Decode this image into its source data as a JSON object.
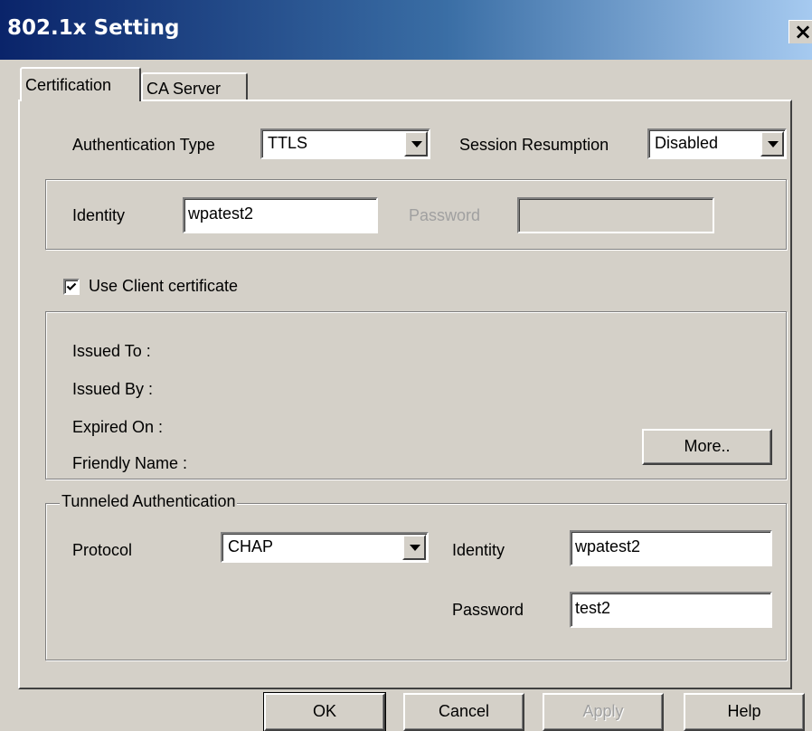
{
  "window": {
    "title": "802.1x Setting",
    "close_glyph": "×"
  },
  "tabs": [
    {
      "label": "Certification",
      "active": true
    },
    {
      "label": "CA Server",
      "active": false
    }
  ],
  "certification": {
    "auth_type_label": "Authentication Type",
    "auth_type_value": "TTLS",
    "session_resumption_label": "Session Resumption",
    "session_resumption_value": "Disabled",
    "identity_label": "Identity",
    "identity_value": "wpatest2",
    "password_label": "Password",
    "password_value": "",
    "use_client_cert_label": "Use Client certificate",
    "use_client_cert_checked": true,
    "cert_info": {
      "issued_to": "Issued To :",
      "issued_by": "Issued By :",
      "expired_on": "Expired On :",
      "friendly_name": "Friendly Name :"
    },
    "more_button": "More.."
  },
  "tunneled": {
    "caption": "Tunneled Authentication",
    "protocol_label": "Protocol",
    "protocol_value": "CHAP",
    "identity_label": "Identity",
    "identity_value": "wpatest2",
    "password_label": "Password",
    "password_value": "test2"
  },
  "buttons": {
    "ok": "OK",
    "cancel": "Cancel",
    "apply": "Apply",
    "help": "Help"
  },
  "colors": {
    "dialog_face": "#d4d0c8",
    "title_gradient_start": "#0a246a",
    "title_gradient_end": "#a6caf0",
    "disabled_text": "#a0a0a0"
  }
}
